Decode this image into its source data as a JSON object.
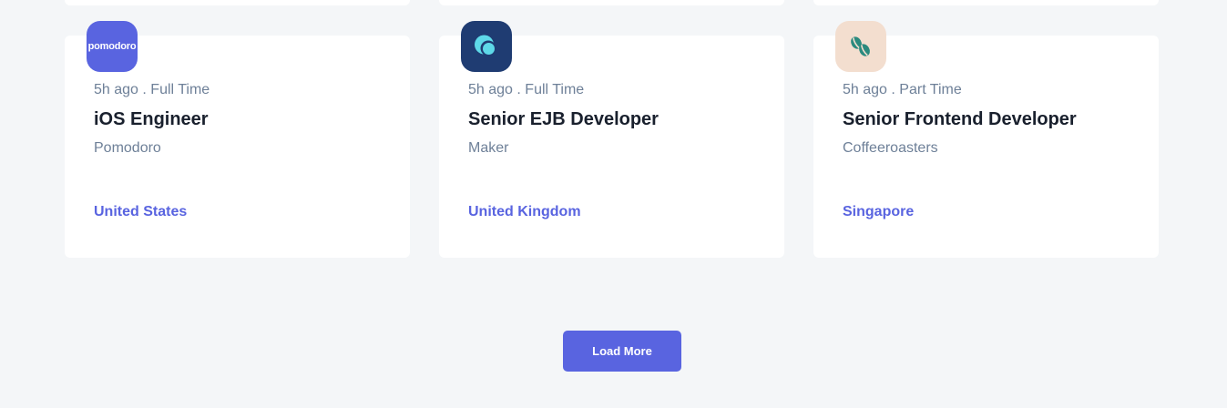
{
  "colors": {
    "background": "#f4f6f8",
    "card": "#ffffff",
    "accent": "#5964e0",
    "title": "#19202d",
    "muted": "#6e8098"
  },
  "jobs": [
    {
      "logo_text": "pomodoro",
      "logo_bg": "#5964e0",
      "logo_icon": "pomodoro-logo",
      "posted": "5h ago",
      "separator": ".",
      "contract": "Full Time",
      "position": "iOS Engineer",
      "company": "Pomodoro",
      "location": "United States"
    },
    {
      "logo_text": "",
      "logo_bg": "#1f3c72",
      "logo_icon": "maker-logo",
      "posted": "5h ago",
      "separator": ".",
      "contract": "Full Time",
      "position": "Senior EJB Developer",
      "company": "Maker",
      "location": "United Kingdom"
    },
    {
      "logo_text": "",
      "logo_bg": "#f3decf",
      "logo_icon": "coffee-beans-logo",
      "posted": "5h ago",
      "separator": ".",
      "contract": "Part Time",
      "position": "Senior Frontend Developer",
      "company": "Coffeeroasters",
      "location": "Singapore"
    }
  ],
  "load_more": {
    "label": "Load More"
  }
}
